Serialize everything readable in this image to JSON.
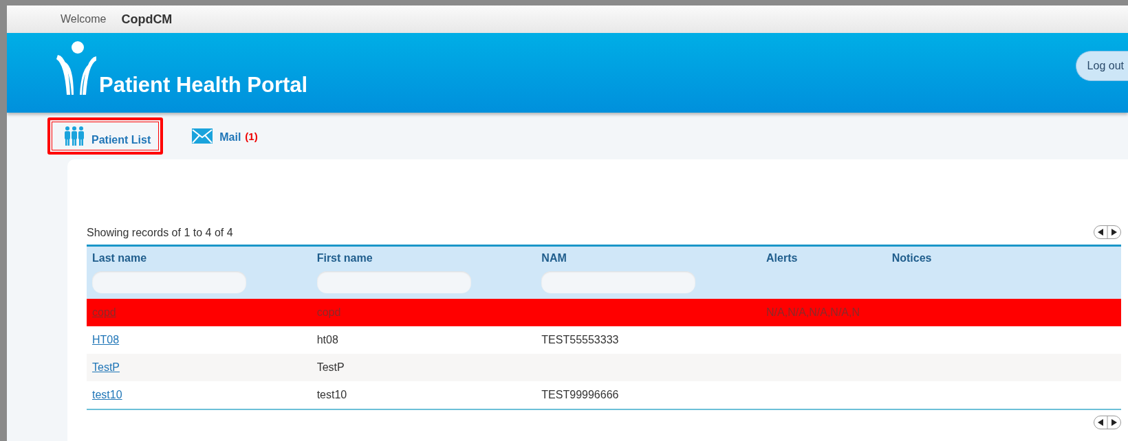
{
  "welcome": {
    "label": "Welcome",
    "user": "CopdCM"
  },
  "header": {
    "title": "Patient Health Portal",
    "logout": "Log out"
  },
  "nav": [
    {
      "label": "Patient List",
      "kind": "people",
      "selected": true
    },
    {
      "label": "Mail",
      "kind": "mail",
      "count": "(1)",
      "selected": false
    }
  ],
  "table": {
    "summary": "Showing records of 1 to 4 of 4",
    "columns": [
      {
        "label": "Last name",
        "filter": true
      },
      {
        "label": "First name",
        "filter": true
      },
      {
        "label": "NAM",
        "filter": true
      },
      {
        "label": "Alerts",
        "filter": false
      },
      {
        "label": "Notices",
        "filter": false
      }
    ],
    "rows": [
      {
        "alert": true,
        "last_name": "copd",
        "first_name": "copd",
        "alerts": "N/A,N/A,N/A,N/A,N"
      },
      {
        "alert": false,
        "last_name": "HT08",
        "first_name": "ht08",
        "nam": "TEST55553333"
      },
      {
        "alert": false,
        "last_name": "TestP",
        "first_name": "TestP"
      },
      {
        "alert": false,
        "last_name": "test10",
        "first_name": "test10",
        "nam": "TEST99996666"
      }
    ]
  }
}
